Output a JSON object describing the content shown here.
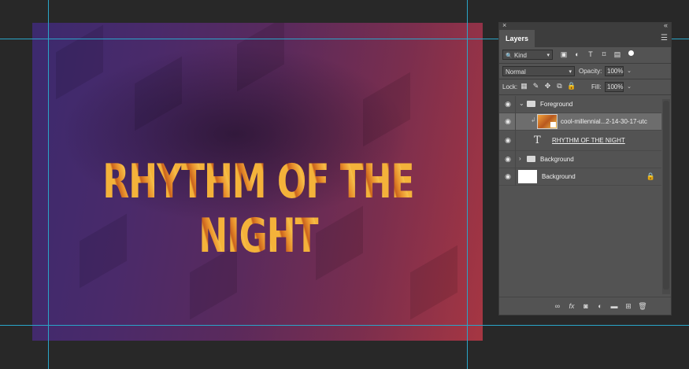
{
  "canvas": {
    "title_text": "RHYTHM OF THE NIGHT"
  },
  "layers_panel": {
    "close_icon": "×",
    "collapse_icon": "«",
    "tab_label": "Layers",
    "menu_icon": "☰",
    "filter": {
      "kind_label": "Kind",
      "search_icon": "🔍"
    },
    "blend_mode": "Normal",
    "opacity_label": "Opacity:",
    "opacity_value": "100%",
    "lock_label": "Lock:",
    "fill_label": "Fill:",
    "fill_value": "100%",
    "layers": [
      {
        "name": "Foreground",
        "kind": "group",
        "expanded": true
      },
      {
        "name": "cool-millennial...2-14-30-17-utc",
        "kind": "smart-object",
        "selected": true
      },
      {
        "name": "RHYTHM OF THE NIGHT",
        "kind": "text"
      },
      {
        "name": "Background",
        "kind": "group",
        "expanded": false
      },
      {
        "name": "Background",
        "kind": "pixel",
        "locked": true
      }
    ]
  }
}
